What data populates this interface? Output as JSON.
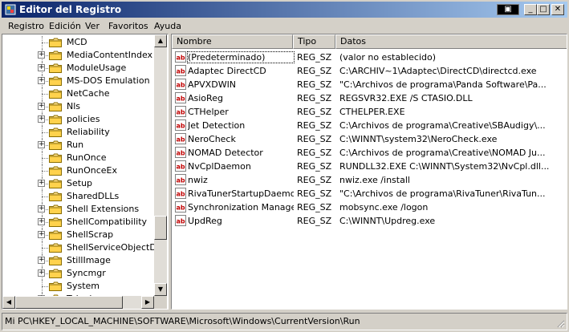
{
  "window": {
    "title": "Editor del Registro"
  },
  "menu": [
    "Registro",
    "Edición",
    "Ver",
    "Favoritos",
    "Ayuda"
  ],
  "tree": {
    "items": [
      {
        "label": "MCD",
        "expandable": false
      },
      {
        "label": "MediaContentIndex",
        "expandable": true
      },
      {
        "label": "ModuleUsage",
        "expandable": true
      },
      {
        "label": "MS-DOS Emulation",
        "expandable": true
      },
      {
        "label": "NetCache",
        "expandable": false
      },
      {
        "label": "Nls",
        "expandable": true
      },
      {
        "label": "policies",
        "expandable": true
      },
      {
        "label": "Reliability",
        "expandable": false
      },
      {
        "label": "Run",
        "expandable": true
      },
      {
        "label": "RunOnce",
        "expandable": false
      },
      {
        "label": "RunOnceEx",
        "expandable": false
      },
      {
        "label": "Setup",
        "expandable": true
      },
      {
        "label": "SharedDLLs",
        "expandable": false
      },
      {
        "label": "Shell Extensions",
        "expandable": true
      },
      {
        "label": "ShellCompatibility",
        "expandable": true
      },
      {
        "label": "ShellScrap",
        "expandable": true
      },
      {
        "label": "ShellServiceObjectDela",
        "expandable": false
      },
      {
        "label": "StillImage",
        "expandable": true
      },
      {
        "label": "Syncmgr",
        "expandable": true
      },
      {
        "label": "System",
        "expandable": false
      },
      {
        "label": "Telephony",
        "expandable": true
      }
    ]
  },
  "list": {
    "columns": [
      "Nombre",
      "Tipo",
      "Datos"
    ],
    "rows": [
      {
        "name": "(Predeterminado)",
        "type": "REG_SZ",
        "data": "(valor no establecido)"
      },
      {
        "name": "Adaptec DirectCD",
        "type": "REG_SZ",
        "data": "C:\\ARCHIV~1\\Adaptec\\DirectCD\\directcd.exe"
      },
      {
        "name": "APVXDWIN",
        "type": "REG_SZ",
        "data": "\"C:\\Archivos de programa\\Panda Software\\Pa..."
      },
      {
        "name": "AsioReg",
        "type": "REG_SZ",
        "data": "REGSVR32.EXE /S CTASIO.DLL"
      },
      {
        "name": "CTHelper",
        "type": "REG_SZ",
        "data": "CTHELPER.EXE"
      },
      {
        "name": "Jet Detection",
        "type": "REG_SZ",
        "data": "C:\\Archivos de programa\\Creative\\SBAudigy\\..."
      },
      {
        "name": "NeroCheck",
        "type": "REG_SZ",
        "data": "C:\\WINNT\\system32\\NeroCheck.exe"
      },
      {
        "name": "NOMAD Detector",
        "type": "REG_SZ",
        "data": "C:\\Archivos de programa\\Creative\\NOMAD Ju..."
      },
      {
        "name": "NvCplDaemon",
        "type": "REG_SZ",
        "data": "RUNDLL32.EXE C:\\WINNT\\System32\\NvCpl.dll..."
      },
      {
        "name": "nwiz",
        "type": "REG_SZ",
        "data": "nwiz.exe /install"
      },
      {
        "name": "RivaTunerStartupDaemon",
        "type": "REG_SZ",
        "data": "\"C:\\Archivos de programa\\RivaTuner\\RivaTun..."
      },
      {
        "name": "Synchronization Manager",
        "type": "REG_SZ",
        "data": "mobsync.exe /logon"
      },
      {
        "name": "UpdReg",
        "type": "REG_SZ",
        "data": "C:\\WINNT\\Updreg.exe"
      }
    ]
  },
  "status": {
    "path": "Mi PC\\HKEY_LOCAL_MACHINE\\SOFTWARE\\Microsoft\\Windows\\CurrentVersion\\Run"
  }
}
